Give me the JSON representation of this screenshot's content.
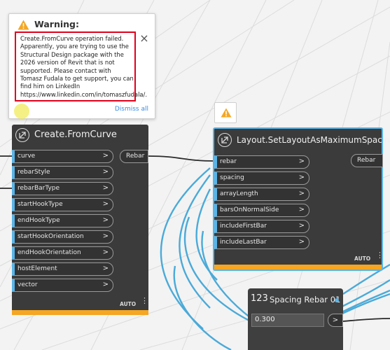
{
  "warning_popup": {
    "title": "Warning:",
    "message": "Create.FromCurve operation failed. Apparently, you are trying to use the Structural Design package with the 2026 version of Revit that is not supported. Please contact with Tomasz Fudala to get support, you can find him on LinkedIn https://www.linkedin.com/in/tomaszfudala/.",
    "dismiss_label": "Dismiss all",
    "close_glyph": "×"
  },
  "create_node": {
    "title": "Create.FromCurve",
    "inputs": [
      "curve",
      "rebarStyle",
      "rebarBarType",
      "startHookType",
      "endHookType",
      "startHookOrientation",
      "endHookOrientation",
      "hostElement",
      "vector"
    ],
    "output": "Rebar",
    "lacing": "AUTO",
    "status": "warning"
  },
  "layout_node": {
    "title": "Layout.SetLayoutAsMaximumSpacing",
    "inputs": [
      "rebar",
      "spacing",
      "arrayLength",
      "barsOnNormalSide",
      "includeFirstBar",
      "includeLastBar"
    ],
    "output": "Rebar",
    "lacing": "AUTO",
    "status": "warning"
  },
  "spacing_node": {
    "icon_text": "123",
    "title": "Spacing Rebar 01",
    "value": "0.300",
    "output_arrow": ">"
  },
  "port_arrow": ">",
  "colors": {
    "warning": "#f5a623",
    "error_outline": "#e0001b",
    "selection": "#5ab4e6",
    "node_body": "#3b3b3b",
    "link": "#3a8dde"
  }
}
